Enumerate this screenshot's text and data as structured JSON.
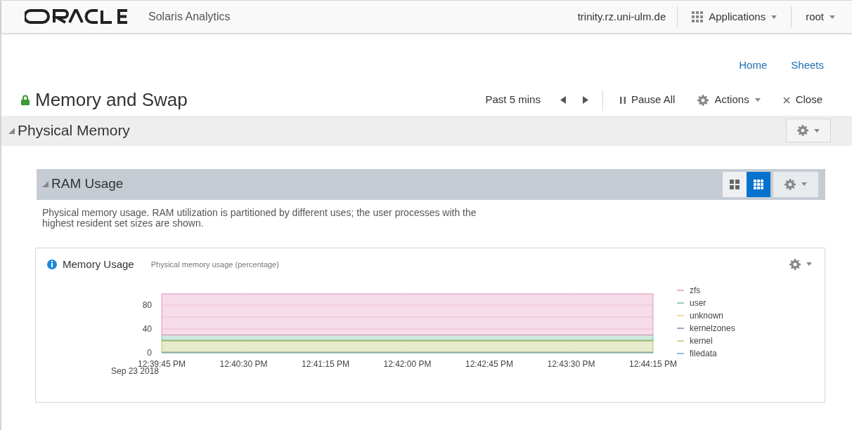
{
  "header": {
    "product": "Solaris Analytics",
    "host": "trinity.rz.uni-ulm.de",
    "applications": "Applications",
    "user": "root"
  },
  "nav_links": [
    "Home",
    "Sheets"
  ],
  "sheet": {
    "title": "Memory and Swap",
    "locked": true,
    "range": "Past 5 mins",
    "pause": "Pause All",
    "actions": "Actions",
    "close": "Close"
  },
  "section": {
    "title": "Physical Memory",
    "expanded": true
  },
  "panel": {
    "title": "RAM Usage",
    "expanded": true,
    "layouts": [
      {
        "kind": "large",
        "selected": false
      },
      {
        "kind": "small",
        "selected": true
      }
    ],
    "description": "Physical memory usage. RAM utilization is partitioned by different uses; the user processes with the highest resident set sizes are shown."
  },
  "widget": {
    "title": "Memory Usage",
    "subtitle": "Physical memory usage (percentage)",
    "date": "Sep 23 2018",
    "chart_data": {
      "type": "area",
      "stacked": true,
      "legend": "right",
      "categories": [
        "12:39:45 PM",
        "12:40:30 PM",
        "12:41:15 PM",
        "12:42:00 PM",
        "12:42:45 PM",
        "12:43:30 PM",
        "12:44:15 PM"
      ],
      "ylim": [
        0,
        100
      ],
      "yticks": [
        0,
        40,
        80
      ],
      "series": [
        {
          "name": "filedata",
          "color": "#3c8fd0",
          "values": [
            1,
            1,
            1,
            1,
            1,
            1,
            1
          ]
        },
        {
          "name": "kernel",
          "color": "#a5b84a",
          "values": [
            19,
            19,
            19,
            19,
            19,
            19,
            19
          ]
        },
        {
          "name": "kernelzones",
          "color": "#8a5aa6",
          "values": [
            null,
            null,
            null,
            null,
            null,
            null,
            null
          ]
        },
        {
          "name": "unknown",
          "color": "#e8c26a",
          "values": [
            1,
            1,
            1,
            1,
            1,
            1,
            1
          ]
        },
        {
          "name": "user",
          "color": "#4fb08c",
          "values": [
            9,
            9,
            9,
            9,
            9,
            9,
            9
          ]
        },
        {
          "name": "zfs",
          "color": "#e07fae",
          "values": [
            69,
            69,
            69,
            69,
            69,
            69,
            69
          ]
        }
      ]
    }
  }
}
